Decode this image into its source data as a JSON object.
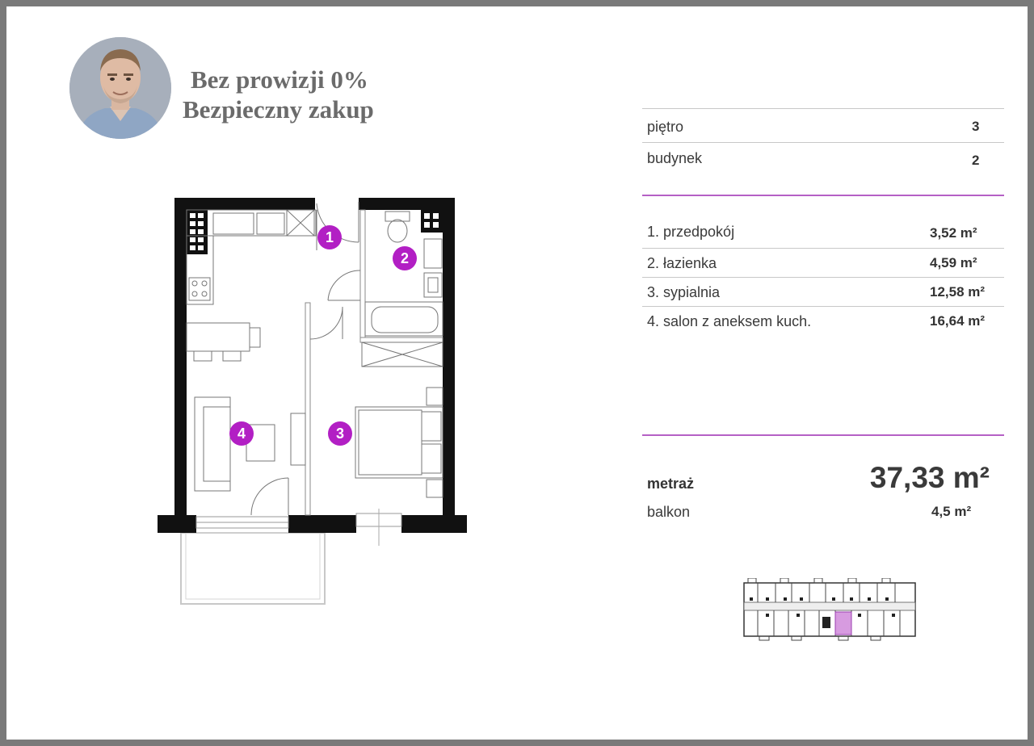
{
  "promo": {
    "line1": "Bez prowizji 0%",
    "line2": "Bezpieczny zakup"
  },
  "details": {
    "floor_label": "piętro",
    "floor_value": "3",
    "building_label": "budynek",
    "building_value": "2"
  },
  "rooms": [
    {
      "label": "1. przedpokój",
      "area": "3,52 m²",
      "number": "1"
    },
    {
      "label": "2. łazienka",
      "area": "4,59 m²",
      "number": "2"
    },
    {
      "label": "3. sypialnia",
      "area": "12,58 m²",
      "number": "3"
    },
    {
      "label": "4. salon z aneksem kuch.",
      "area": "16,64 m²",
      "number": "4"
    }
  ],
  "summary": {
    "area_label": "metraż",
    "area_value": "37,33 m²",
    "balcony_label": "balkon",
    "balcony_value": "4,5 m²"
  },
  "colors": {
    "accent": "#b21fc4",
    "rule": "#b560c5",
    "wall": "#111111",
    "highlight": "#d79be0"
  }
}
